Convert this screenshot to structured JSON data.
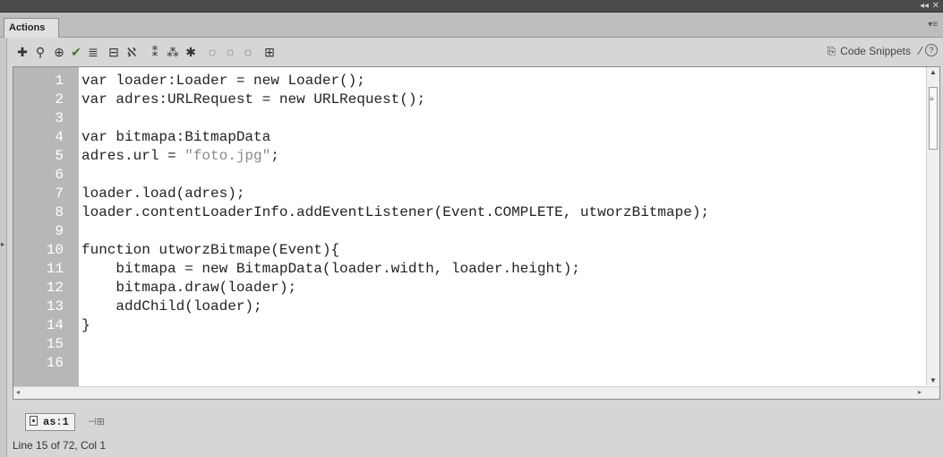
{
  "window": {
    "controls": [
      "◂◂",
      "✕"
    ]
  },
  "panel": {
    "tab_label": "Actions",
    "menu_icon": "panel-menu-icon"
  },
  "toolbar": {
    "buttons": [
      {
        "name": "add-statement-icon",
        "glyph": "✚"
      },
      {
        "name": "find-icon",
        "glyph": "⚲"
      },
      {
        "name": "insert-target-path-icon",
        "glyph": "⊕"
      },
      {
        "name": "check-syntax-icon",
        "glyph": "✔"
      },
      {
        "name": "auto-format-icon",
        "glyph": "≣"
      },
      {
        "name": "show-code-hint-icon",
        "glyph": "⊟"
      },
      {
        "name": "debug-options-icon",
        "glyph": "ℵ"
      },
      {
        "name": "collapse-between-braces-icon",
        "glyph": "⁑"
      },
      {
        "name": "collapse-selection-icon",
        "glyph": "⁂"
      },
      {
        "name": "expand-all-icon",
        "glyph": "✱"
      },
      {
        "name": "apply-block-comment-icon",
        "glyph": "◌"
      },
      {
        "name": "apply-line-comment-icon",
        "glyph": "◌"
      },
      {
        "name": "remove-comment-icon",
        "glyph": "◌"
      },
      {
        "name": "toggle-script-assist-icon",
        "glyph": "⊞"
      }
    ],
    "code_snippets_label": "Code Snippets",
    "help_label": "?"
  },
  "editor": {
    "line_numbers": [
      "1",
      "2",
      "3",
      "4",
      "5",
      "6",
      "7",
      "8",
      "9",
      "10",
      "11",
      "12",
      "13",
      "14",
      "15",
      "16"
    ],
    "lines": [
      "var loader:Loader = new Loader();",
      "var adres:URLRequest = new URLRequest();",
      "",
      "var bitmapa:BitmapData",
      "adres.url = \"foto.jpg\";",
      "",
      "loader.load(adres);",
      "loader.contentLoaderInfo.addEventListener(Event.COMPLETE, utworzBitmape);",
      "",
      "function utworzBitmape(Event){",
      "    bitmapa = new BitmapData(loader.width, loader.height);",
      "    bitmapa.draw(loader);",
      "    addChild(loader);",
      "}",
      "",
      ""
    ]
  },
  "script_tab": {
    "label": "as:1"
  },
  "status": {
    "text": "Line 15 of 72, Col 1"
  }
}
